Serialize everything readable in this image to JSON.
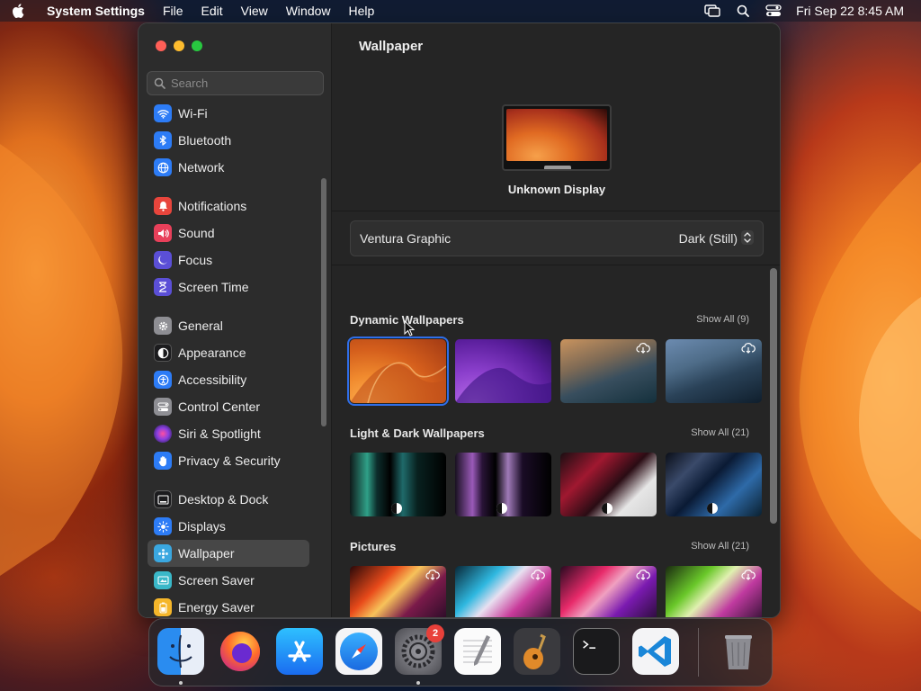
{
  "menubar": {
    "app_name": "System Settings",
    "menus": [
      "File",
      "Edit",
      "View",
      "Window",
      "Help"
    ],
    "clock": "Fri Sep 22  8:45 AM"
  },
  "sidebar": {
    "search_placeholder": "Search",
    "groups": [
      [
        {
          "label": "Wi-Fi",
          "icon": "wifi-icon",
          "color": "#2d7cf6"
        },
        {
          "label": "Bluetooth",
          "icon": "bluetooth-icon",
          "color": "#2d7cf6"
        },
        {
          "label": "Network",
          "icon": "network-globe-icon",
          "color": "#2d7cf6"
        }
      ],
      [
        {
          "label": "Notifications",
          "icon": "bell-icon",
          "color": "#e8453c"
        },
        {
          "label": "Sound",
          "icon": "speaker-icon",
          "color": "#e8405a"
        },
        {
          "label": "Focus",
          "icon": "moon-icon",
          "color": "#5b4fd6"
        },
        {
          "label": "Screen Time",
          "icon": "hourglass-icon",
          "color": "#5b4fd6"
        }
      ],
      [
        {
          "label": "General",
          "icon": "gear-icon",
          "color": "#8e8e93"
        },
        {
          "label": "Appearance",
          "icon": "appearance-icon",
          "color": "#1c1c1e"
        },
        {
          "label": "Accessibility",
          "icon": "accessibility-icon",
          "color": "#2d7cf6"
        },
        {
          "label": "Control Center",
          "icon": "control-center-icon",
          "color": "#8e8e93"
        },
        {
          "label": "Siri & Spotlight",
          "icon": "siri-icon",
          "color": "#a84fd6"
        },
        {
          "label": "Privacy & Security",
          "icon": "hand-icon",
          "color": "#2d7cf6"
        }
      ],
      [
        {
          "label": "Desktop & Dock",
          "icon": "desktop-dock-icon",
          "color": "#1c1c1e"
        },
        {
          "label": "Displays",
          "icon": "sun-icon",
          "color": "#2d7cf6"
        },
        {
          "label": "Wallpaper",
          "icon": "wallpaper-icon",
          "color": "#3aa7e0",
          "selected": true
        },
        {
          "label": "Screen Saver",
          "icon": "screen-saver-icon",
          "color": "#3ab8c8"
        },
        {
          "label": "Energy Saver",
          "icon": "battery-icon",
          "color": "#f5b62a"
        }
      ]
    ]
  },
  "main": {
    "title": "Wallpaper",
    "display_name": "Unknown Display",
    "wallpaper_name": "Ventura Graphic",
    "mode_value": "Dark (Still)",
    "sections": [
      {
        "title": "Dynamic Wallpapers",
        "show_all": "Show All (9)"
      },
      {
        "title": "Light & Dark Wallpapers",
        "show_all": "Show All (21)"
      },
      {
        "title": "Pictures",
        "show_all": "Show All (21)"
      }
    ]
  },
  "dock": {
    "apps": [
      "Finder",
      "Firefox",
      "App Store",
      "Safari",
      "System Settings",
      "TextEdit",
      "GarageBand",
      "Terminal",
      "Visual Studio Code",
      "Trash"
    ],
    "settings_badge": "2"
  }
}
